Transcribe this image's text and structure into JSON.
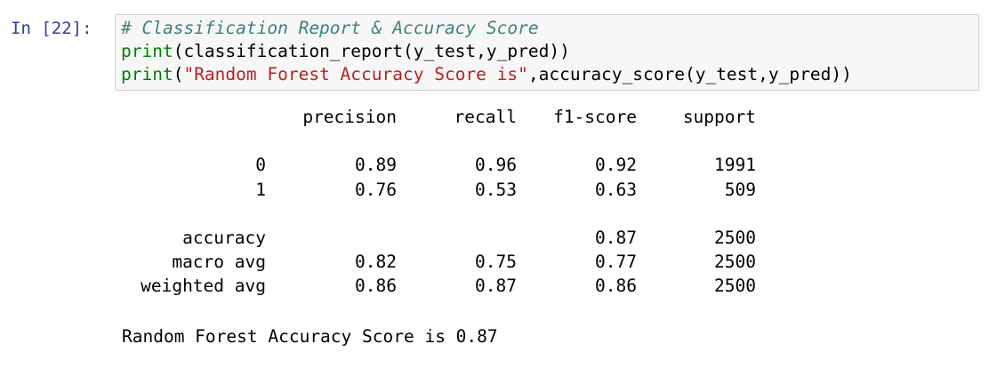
{
  "cell": {
    "prompt": "In [22]:",
    "code": {
      "comment": "# Classification Report & Accuracy Score",
      "line2_builtin": "print",
      "line2_rest": "(classification_report(y_test,y_pred))",
      "line3_builtin": "print",
      "line3_open": "(",
      "line3_string": "\"Random Forest Accuracy Score is\"",
      "line3_rest": ",accuracy_score(y_test,y_pred))"
    }
  },
  "report": {
    "headers": [
      "",
      "precision",
      "recall",
      "f1-score",
      "support"
    ],
    "class_rows": [
      [
        "0",
        "0.89",
        "0.96",
        "0.92",
        "1991"
      ],
      [
        "1",
        "0.76",
        "0.53",
        "0.63",
        "509"
      ]
    ],
    "summary_rows": [
      [
        "accuracy",
        "",
        "",
        "0.87",
        "2500"
      ],
      [
        "macro avg",
        "0.82",
        "0.75",
        "0.77",
        "2500"
      ],
      [
        "weighted avg",
        "0.86",
        "0.87",
        "0.86",
        "2500"
      ]
    ]
  },
  "accuracy_line": "Random Forest Accuracy Score is 0.87"
}
